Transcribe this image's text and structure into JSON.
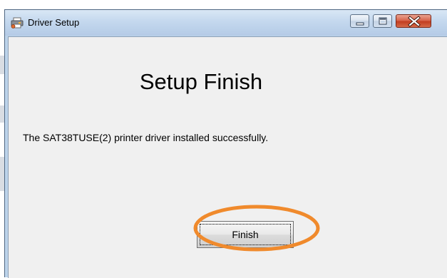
{
  "window": {
    "title": "Driver Setup",
    "icon": "printer-setup-icon"
  },
  "title_controls": {
    "minimize_icon": "minimize-icon",
    "maximize_icon": "maximize-icon",
    "close_icon": "close-icon"
  },
  "content": {
    "heading": "Setup Finish",
    "message": "The  SAT38TUSE(2) printer driver installed successfully.",
    "finish_label": "Finish"
  },
  "annotation": {
    "shape": "ellipse",
    "color": "#f08a2c"
  },
  "colors": {
    "titlebar": "#c4d8ee",
    "client_bg": "#f0f0f0",
    "close_button": "#c23d21"
  }
}
